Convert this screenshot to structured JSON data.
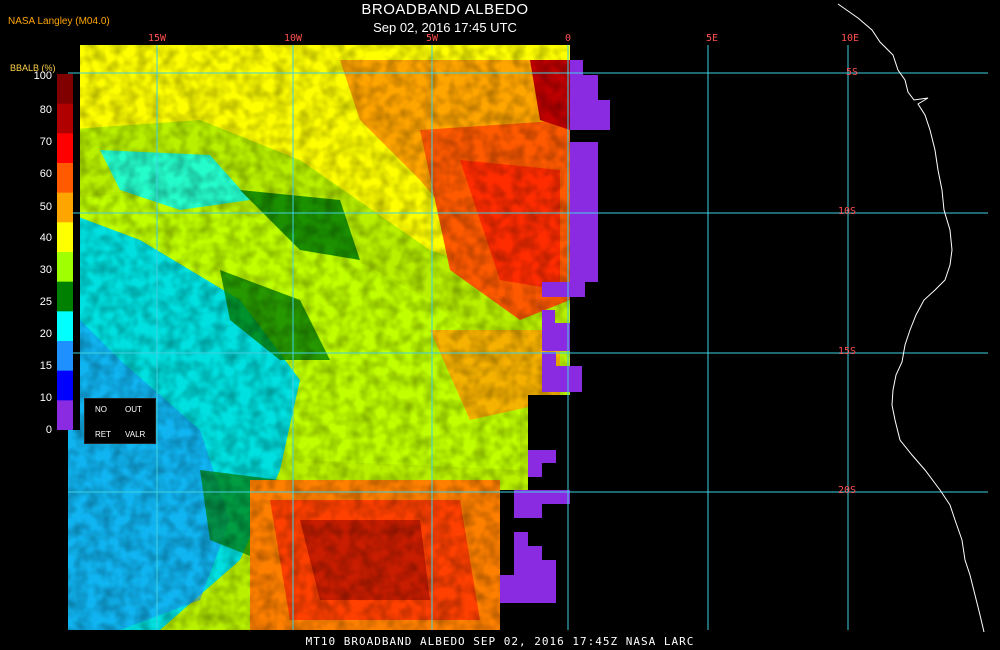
{
  "header": {
    "credit": "NASA Langley (M04.0)",
    "title": "BROADBAND ALBEDO",
    "subtitle": "Sep 02, 2016 17:45 UTC"
  },
  "footer": {
    "caption": "MT10  BROADBAND ALBEDO  SEP 02, 2016 17:45Z  NASA LARC"
  },
  "map": {
    "longitude_labels": [
      "15W",
      "10W",
      "5W",
      "0",
      "5E",
      "10E"
    ],
    "latitude_labels": [
      "5S",
      "10S",
      "15S",
      "20S"
    ],
    "grid_color": "#40d0e0",
    "label_color": "#ff5050",
    "no_data_color": "#8a2be2"
  },
  "legend": {
    "title": "BBALB (%)",
    "ticks": [
      "100",
      "80",
      "70",
      "60",
      "50",
      "40",
      "30",
      "25",
      "20",
      "15",
      "10",
      "0"
    ],
    "colors": [
      "#800000",
      "#b00000",
      "#ff0000",
      "#ff5a00",
      "#ffa500",
      "#ffff00",
      "#a0ff00",
      "#008000",
      "#00ffff",
      "#1e90ff",
      "#0000ff",
      "#8a2be2"
    ],
    "no_data": {
      "line1_left": "NO",
      "line1_right": "OUT",
      "line2_left": "RET",
      "line2_right": "VALR"
    }
  }
}
